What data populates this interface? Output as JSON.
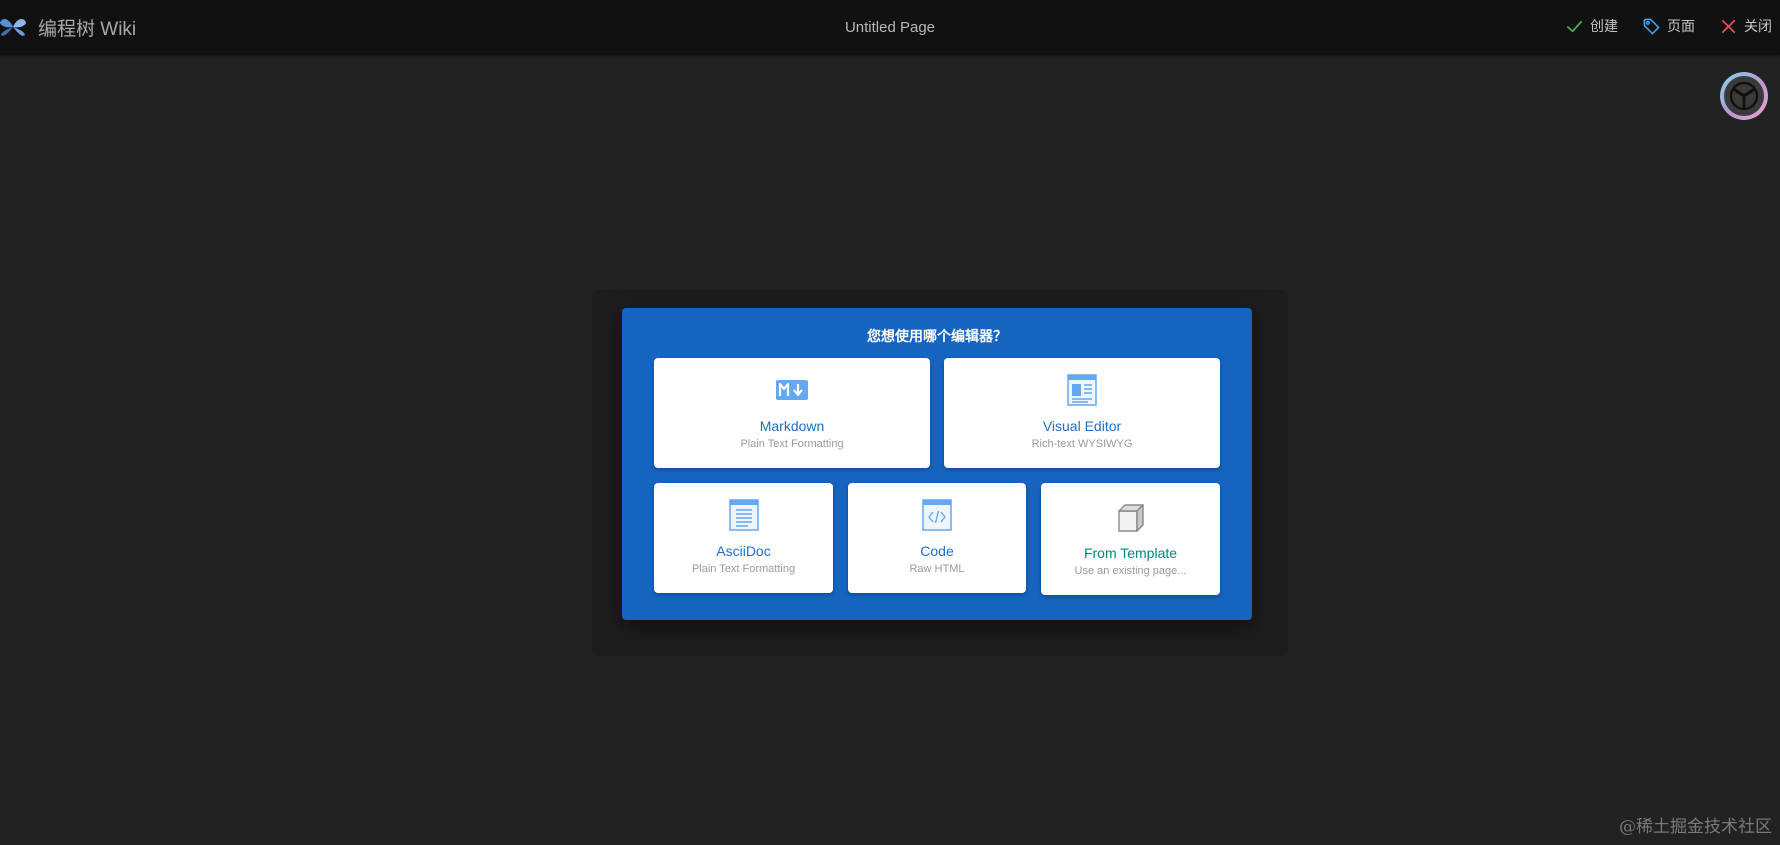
{
  "header": {
    "brand_title": "编程树 Wiki",
    "page_title": "Untitled Page",
    "actions": [
      {
        "label": "创建",
        "icon": "check-icon",
        "color": "#4caf50"
      },
      {
        "label": "页面",
        "icon": "tag-icon",
        "color": "#42a5f5"
      },
      {
        "label": "关闭",
        "icon": "close-icon",
        "color": "#ef5350"
      }
    ]
  },
  "dialog": {
    "title": "您想使用哪个编辑器？",
    "background": "#1565c0",
    "editors": [
      {
        "name": "Markdown",
        "description": "Plain Text Formatting",
        "icon": "markdown-icon"
      },
      {
        "name": "Visual Editor",
        "description": "Rich-text WYSIWYG",
        "icon": "visual-editor-icon"
      },
      {
        "name": "AsciiDoc",
        "description": "Plain Text Formatting",
        "icon": "asciidoc-icon"
      },
      {
        "name": "Code",
        "description": "Raw HTML",
        "icon": "code-icon"
      },
      {
        "name": "From Template",
        "description": "Use an existing page...",
        "icon": "cube-icon",
        "name_color": "#00897b"
      }
    ]
  },
  "watermark": "@稀土掘金技术社区"
}
